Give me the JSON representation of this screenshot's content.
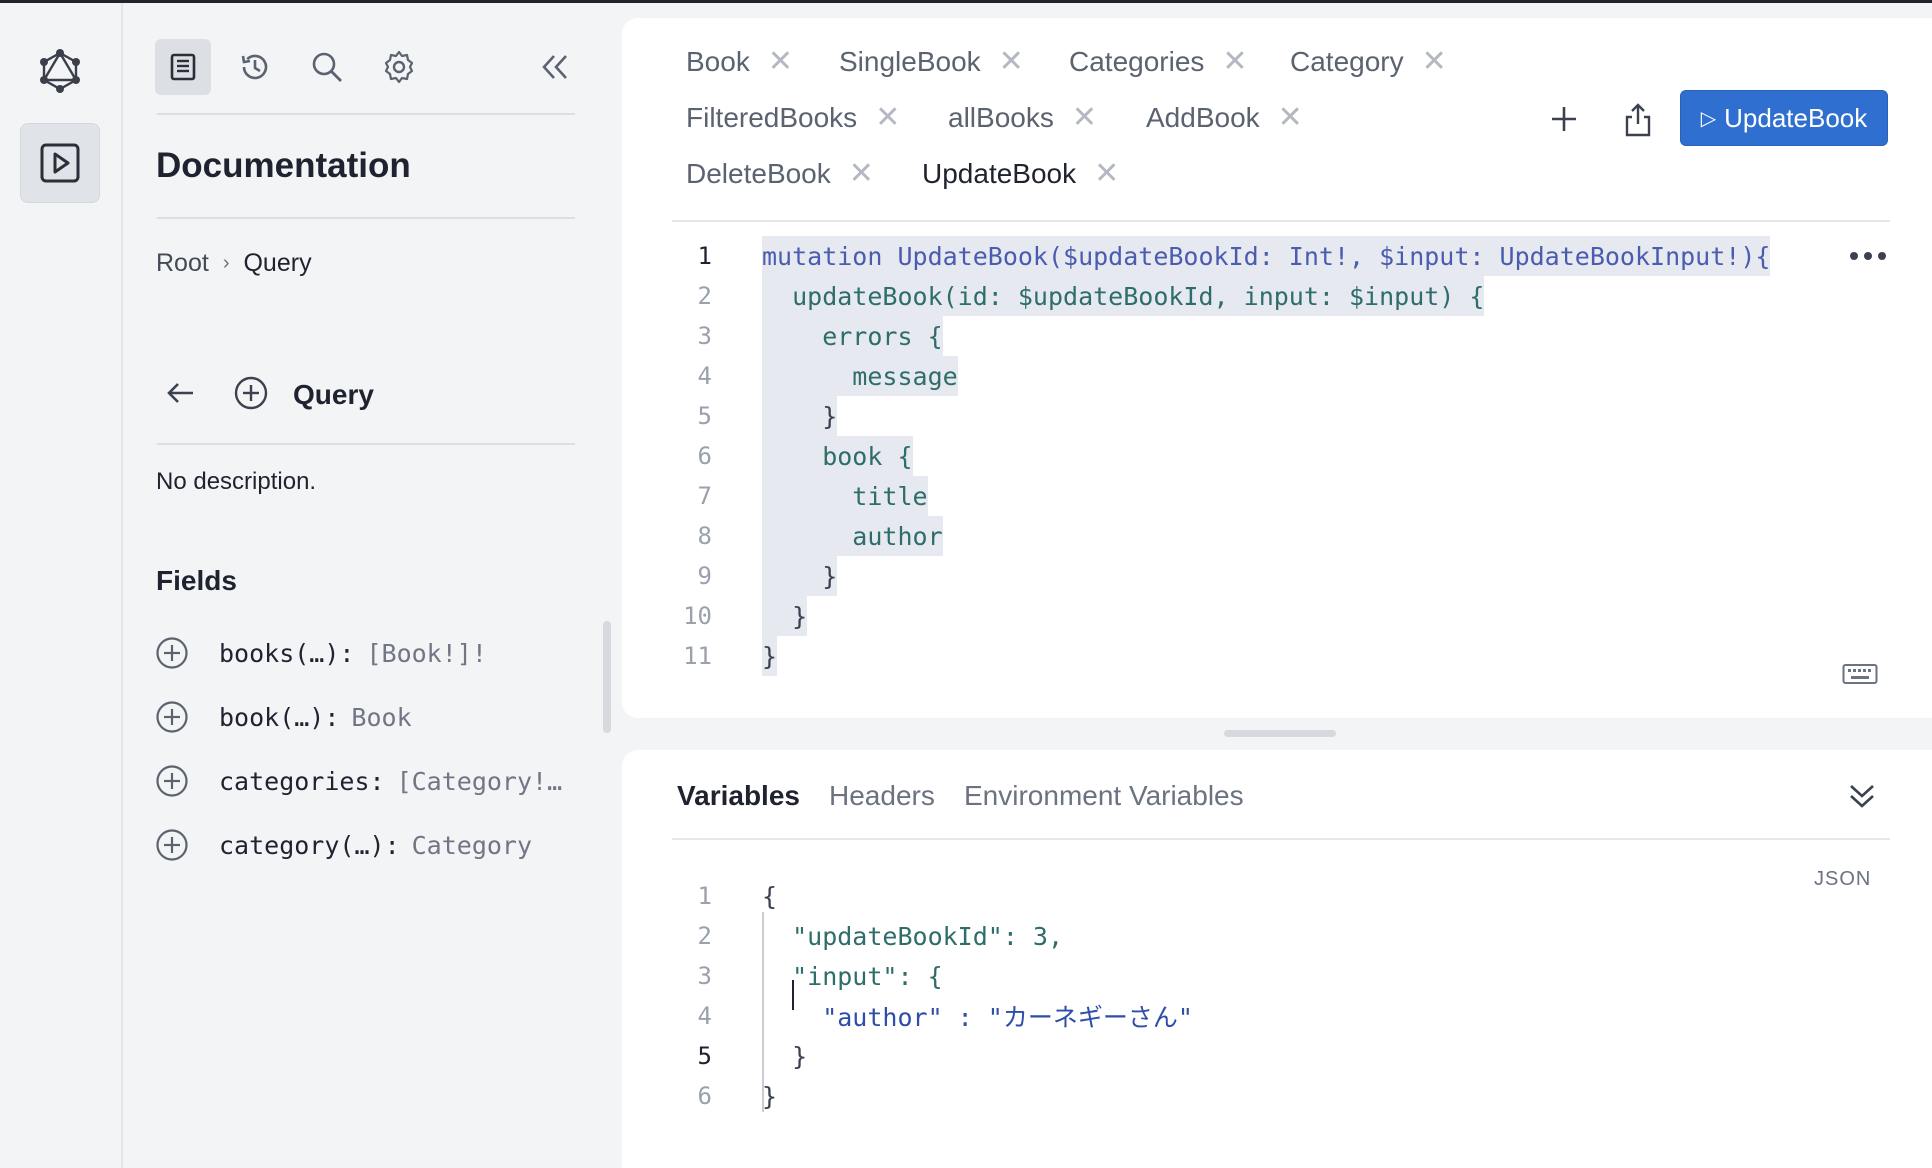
{
  "rail": {
    "logo_icon": "graphql-logo-icon",
    "explorer_icon": "play-square-icon"
  },
  "docs": {
    "toolbar_icons": [
      "docs-icon",
      "history-icon",
      "search-icon",
      "settings-icon",
      "collapse-double-chevron-icon"
    ],
    "title": "Documentation",
    "breadcrumb": {
      "root": "Root",
      "separator": "›",
      "current": "Query"
    },
    "section_title": "Query",
    "description": "No description.",
    "fields_title": "Fields",
    "fields": [
      {
        "name": "books(…):",
        "type": "[Book!]!"
      },
      {
        "name": "book(…):",
        "type": "Book"
      },
      {
        "name": "categories:",
        "type": "[Category!…"
      },
      {
        "name": "category(…):",
        "type": "Category"
      }
    ]
  },
  "tabs": [
    {
      "label": "Book"
    },
    {
      "label": "SingleBook"
    },
    {
      "label": "Categories"
    },
    {
      "label": "Category"
    },
    {
      "label": "FilteredBooks"
    },
    {
      "label": "allBooks"
    },
    {
      "label": "AddBook"
    },
    {
      "label": "DeleteBook"
    },
    {
      "label": "UpdateBook",
      "active": true
    }
  ],
  "tab_close_glyph": "✕",
  "toolbar": {
    "add_tab_icon": "plus-icon",
    "share_icon": "share-icon",
    "run_label": "UpdateBook",
    "run_glyph": "▷"
  },
  "editor": {
    "line_numbers": [
      "1",
      "2",
      "3",
      "4",
      "5",
      "6",
      "7",
      "8",
      "9",
      "10",
      "11"
    ],
    "active_line": "1",
    "lines": [
      "mutation UpdateBook($updateBookId: Int!, $input: UpdateBookInput!){",
      "  updateBook(id: $updateBookId, input: $input) {",
      "    errors {",
      "      message",
      "    }",
      "    book {",
      "      title",
      "      author",
      "    }",
      "  }",
      "}"
    ],
    "more_icon": "more-horizontal-icon",
    "keyboard_icon": "keyboard-icon"
  },
  "variables_panel": {
    "tabs": [
      "Variables",
      "Headers",
      "Environment Variables"
    ],
    "active_tab": "Variables",
    "collapse_icon": "chevron-double-down-icon",
    "format_label": "JSON",
    "line_numbers": [
      "1",
      "2",
      "3",
      "4",
      "5",
      "6"
    ],
    "active_line": "5",
    "lines": [
      "{",
      "  \"updateBookId\": 3,",
      "  \"input\": {",
      "    \"author\" : \"カーネギーさん\"",
      "  }",
      "}"
    ]
  },
  "colors": {
    "accent": "#2f6fcf",
    "background": "#f3f4f6",
    "card": "#ffffff"
  }
}
